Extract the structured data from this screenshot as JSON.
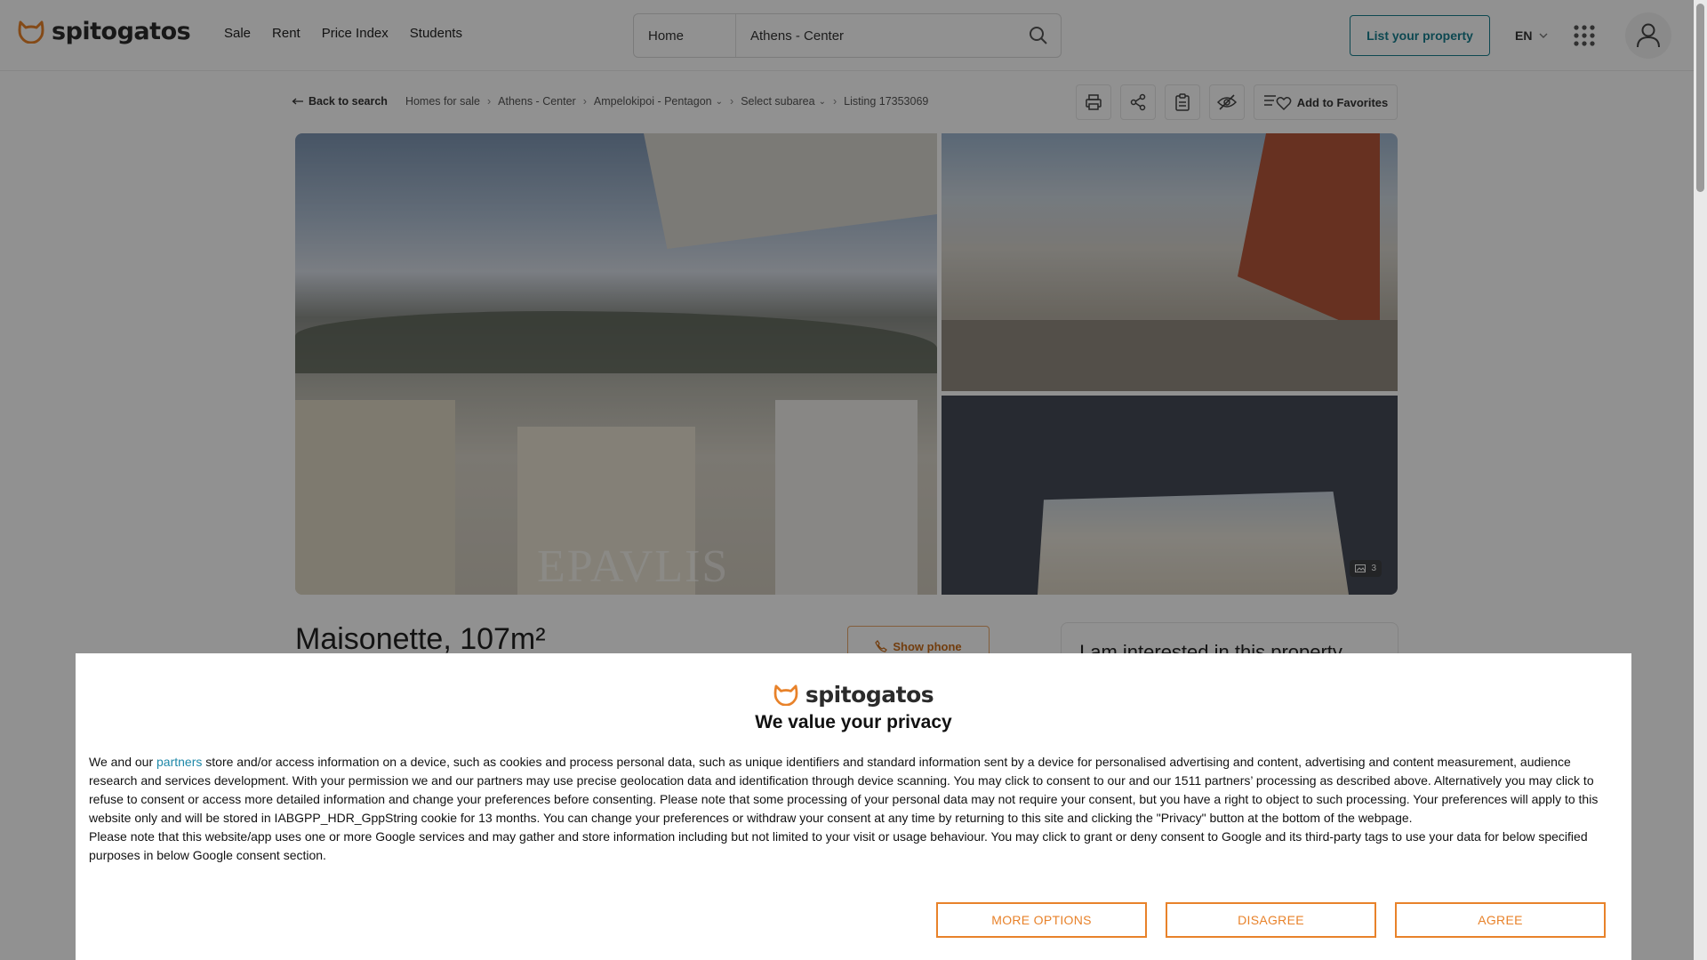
{
  "header": {
    "logo_text": "spitogatos",
    "nav": [
      "Sale",
      "Rent",
      "Price Index",
      "Students"
    ],
    "search": {
      "type_value": "Home",
      "location_value": "Athens - Center"
    },
    "list_property_label": "List your property",
    "language": "EN"
  },
  "breadcrumb": {
    "back_label": "Back to search",
    "items": [
      "Homes for sale",
      "Athens - Center",
      "Ampelokipoi - Pentagon",
      "Select subarea",
      "Listing 17353069"
    ]
  },
  "toolbar": {
    "favorites_label": "Add to Favorites"
  },
  "gallery": {
    "watermark": "EPAVLIS",
    "photo_count": "3"
  },
  "listing": {
    "title": "Maisonette, 107m²",
    "show_phone_label": "Show phone",
    "contact_heading": "I am interested in this property"
  },
  "consent": {
    "logo_text": "spitogatos",
    "title": "We value your privacy",
    "p1_before_link": "We and our ",
    "p1_link": "partners",
    "p1_after_link": " store and/or access information on a device, such as cookies and process personal data, such as unique identifiers and standard information sent by a device for personalised advertising and content, advertising and content measurement, audience research and services development. With your permission we and our partners may use precise geolocation data and identification through device scanning. You may click to consent to our and our 1511 partners’ processing as described above. Alternatively you may click to refuse to consent or access more detailed information and change your preferences before consenting. Please note that some processing of your personal data may not require your consent, but you have a right to object to such processing. Your preferences will apply to this website only and will be stored in IABGPP_HDR_GppString cookie for 13 months. You can change your preferences or withdraw your consent at any time by returning to this site and clicking the \"Privacy\" button at the bottom of the webpage.",
    "p2": "Please note that this website/app uses one or more Google services and may gather and store information including but not limited to your visit or usage behaviour. You may click to grant or deny consent to Google and its third-party tags to use your data for below specified purposes in below Google consent section.",
    "buttons": {
      "more_options": "MORE OPTIONS",
      "disagree": "DISAGREE",
      "agree": "AGREE"
    }
  },
  "colors": {
    "brand_orange": "#e8822a",
    "teal": "#177f8f",
    "link": "#1e88a8"
  }
}
